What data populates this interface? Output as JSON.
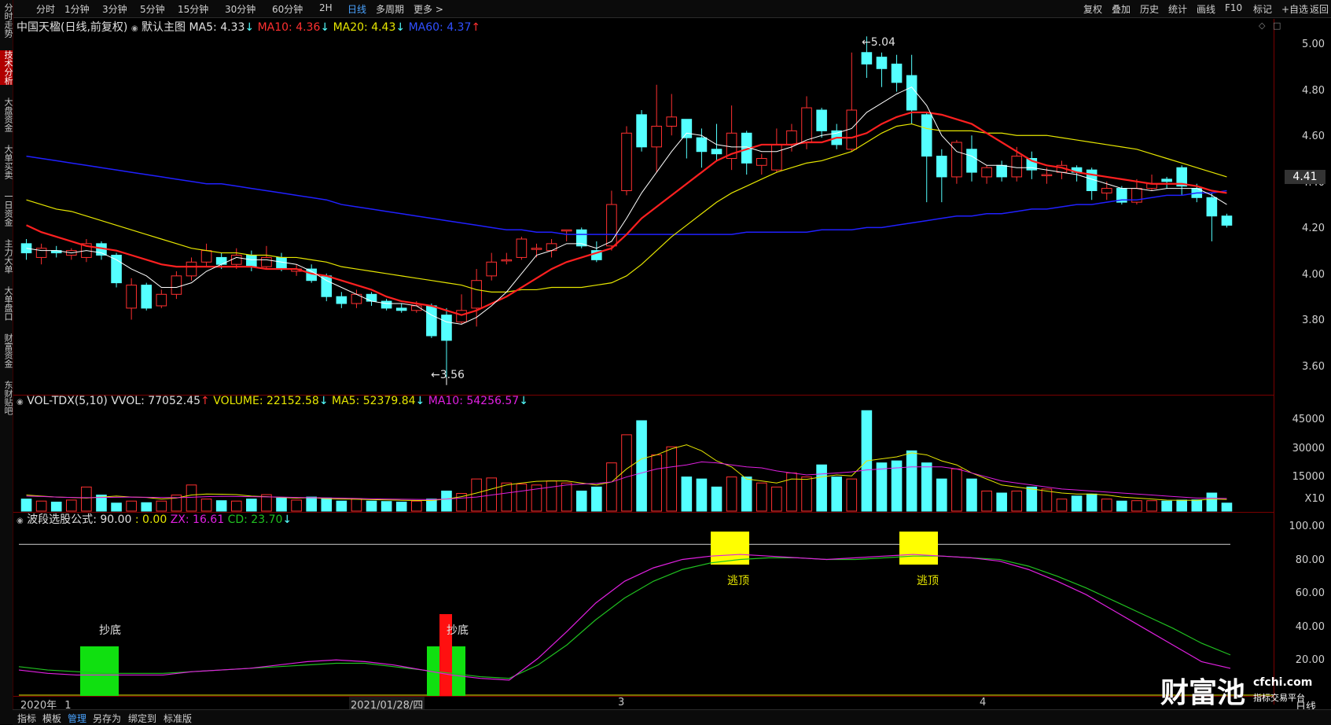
{
  "toolbar": {
    "left_tabs": [
      "分时",
      "1分钟",
      "3分钟",
      "5分钟",
      "15分钟",
      "30分钟",
      "60分钟",
      "2H",
      "日线",
      "多周期",
      "更多 >"
    ],
    "active_tab": "日线",
    "right_buttons": [
      "复权",
      "叠加",
      "历史",
      "统计",
      "画线",
      "F10",
      "标记",
      "+自选",
      "返回"
    ]
  },
  "sidebar": {
    "items": [
      "分时走势",
      "技术分析",
      "大盘资金",
      "大单买卖",
      "一日资金",
      "主力大单",
      "大单盘口",
      "财富资金",
      "东财贴吧"
    ],
    "active": "技术分析"
  },
  "main_chart": {
    "title": "中国天楹(日线,前复权)",
    "template": "默认主图",
    "ma5": "MA5: 4.33",
    "ma5_arrow": "↓",
    "ma10": "MA10: 4.36",
    "ma10_arrow": "↓",
    "ma20": "MA20: 4.43",
    "ma20_arrow": "↓",
    "ma60": "MA60: 4.37",
    "ma60_arrow": "↑",
    "high_label": "5.04",
    "low_label": "3.56",
    "last_price": "4.41",
    "price_ticks": [
      "5.00",
      "4.80",
      "4.60",
      "4.40",
      "4.20",
      "4.00",
      "3.80",
      "3.60"
    ]
  },
  "volume_panel": {
    "name": "VOL-TDX(5,10)",
    "vvol": "VVOL: 77052.45",
    "vvol_arrow": "↑",
    "volume": "VOLUME: 22152.58",
    "volume_arrow": "↓",
    "ma5": "MA5: 52379.84",
    "ma5_arrow": "↓",
    "ma10": "MA10: 54256.57",
    "ma10_arrow": "↓",
    "ticks": [
      "45000",
      "30000",
      "15000",
      "X10"
    ]
  },
  "indicator_panel": {
    "name": "波段选股公式",
    "value1": ": 90.00",
    "value2": ": 0.00",
    "zx": "ZX: 16.61",
    "cd": "CD: 23.70",
    "cd_arrow": "↓",
    "ticks": [
      "100.00",
      "80.00",
      "60.00",
      "40.00",
      "20.00"
    ],
    "signals": {
      "top1": "逃顶",
      "top2": "逃顶",
      "bottom1": "抄底",
      "bottom2": "抄底"
    }
  },
  "dates": {
    "year": "2020年",
    "m1": "1",
    "cursor_date": "2021/01/28/四",
    "m3": "3",
    "m4": "4"
  },
  "bottom_bar": {
    "items": [
      "指标",
      "模板",
      "管理",
      "另存为",
      "绑定到",
      "标准版"
    ],
    "active": "管理",
    "period": "日线"
  },
  "watermark": {
    "brand": "财富池",
    "domain": "cfchi.com",
    "slogan": "指标交易平台"
  },
  "colors": {
    "up": "#ff3030",
    "down": "#54ffff",
    "ma5": "#ffffff",
    "ma10": "#ff2020",
    "ma20": "#e6e600",
    "ma60": "#2020ff",
    "zx": "#e020e0",
    "cd": "#20c020"
  },
  "chart_data": [
    {
      "type": "candlestick",
      "ylim": [
        3.5,
        5.1
      ],
      "candles": [
        [
          4.14,
          4.1,
          4.16,
          4.07
        ],
        [
          4.08,
          4.12,
          4.14,
          4.05
        ],
        [
          4.11,
          4.1,
          4.13,
          4.08
        ],
        [
          4.09,
          4.11,
          4.12,
          4.07
        ],
        [
          4.08,
          4.14,
          4.16,
          4.06
        ],
        [
          4.14,
          4.09,
          4.15,
          4.07
        ],
        [
          4.09,
          3.97,
          4.1,
          3.95
        ],
        [
          3.86,
          3.96,
          3.99,
          3.81
        ],
        [
          3.96,
          3.86,
          3.97,
          3.85
        ],
        [
          3.87,
          3.92,
          3.94,
          3.86
        ],
        [
          3.92,
          4.0,
          4.02,
          3.9
        ],
        [
          4.0,
          4.06,
          4.08,
          3.98
        ],
        [
          4.06,
          4.11,
          4.14,
          4.04
        ],
        [
          4.08,
          4.05,
          4.1,
          4.03
        ],
        [
          4.05,
          4.09,
          4.12,
          4.03
        ],
        [
          4.09,
          4.04,
          4.11,
          4.02
        ],
        [
          4.04,
          4.08,
          4.13,
          4.03
        ],
        [
          4.08,
          4.03,
          4.1,
          4.02
        ],
        [
          4.02,
          4.03,
          4.05,
          4.0
        ],
        [
          4.03,
          3.98,
          4.05,
          3.97
        ],
        [
          4.0,
          3.91,
          4.01,
          3.89
        ],
        [
          3.91,
          3.88,
          3.93,
          3.86
        ],
        [
          3.88,
          3.92,
          3.94,
          3.86
        ],
        [
          3.92,
          3.89,
          3.93,
          3.87
        ],
        [
          3.89,
          3.86,
          3.9,
          3.85
        ],
        [
          3.86,
          3.85,
          3.88,
          3.84
        ],
        [
          3.85,
          3.87,
          3.89,
          3.84
        ],
        [
          3.87,
          3.74,
          3.88,
          3.73
        ],
        [
          3.83,
          3.72,
          3.86,
          3.56
        ],
        [
          3.8,
          3.85,
          3.92,
          3.79
        ],
        [
          3.86,
          3.98,
          4.03,
          3.78
        ],
        [
          4.0,
          4.06,
          4.1,
          3.98
        ],
        [
          4.07,
          4.07,
          4.1,
          4.05
        ],
        [
          4.08,
          4.16,
          4.17,
          4.07
        ],
        [
          4.12,
          4.12,
          4.14,
          4.08
        ],
        [
          4.11,
          4.14,
          4.16,
          4.08
        ],
        [
          4.2,
          4.2,
          4.2,
          4.15
        ],
        [
          4.2,
          4.13,
          4.21,
          4.12
        ],
        [
          4.11,
          4.07,
          4.15,
          4.06
        ],
        [
          4.13,
          4.31,
          4.37,
          4.11
        ],
        [
          4.37,
          4.62,
          4.65,
          4.35
        ],
        [
          4.7,
          4.56,
          4.72,
          4.54
        ],
        [
          4.56,
          4.65,
          4.83,
          4.45
        ],
        [
          4.65,
          4.69,
          4.79,
          4.61
        ],
        [
          4.68,
          4.6,
          4.68,
          4.51
        ],
        [
          4.6,
          4.54,
          4.64,
          4.47
        ],
        [
          4.55,
          4.53,
          4.66,
          4.5
        ],
        [
          4.51,
          4.62,
          4.74,
          4.46
        ],
        [
          4.62,
          4.49,
          4.63,
          4.44
        ],
        [
          4.48,
          4.51,
          4.53,
          4.44
        ],
        [
          4.46,
          4.57,
          4.64,
          4.45
        ],
        [
          4.57,
          4.63,
          4.66,
          4.54
        ],
        [
          4.58,
          4.73,
          4.78,
          4.55
        ],
        [
          4.72,
          4.63,
          4.73,
          4.6
        ],
        [
          4.63,
          4.57,
          4.66,
          4.55
        ],
        [
          4.55,
          4.72,
          4.97,
          4.54
        ],
        [
          4.97,
          4.92,
          5.04,
          4.86
        ],
        [
          4.95,
          4.9,
          4.97,
          4.82
        ],
        [
          4.92,
          4.84,
          4.96,
          4.8
        ],
        [
          4.87,
          4.72,
          4.96,
          4.66
        ],
        [
          4.7,
          4.52,
          4.71,
          4.32
        ],
        [
          4.52,
          4.43,
          4.55,
          4.32
        ],
        [
          4.43,
          4.58,
          4.59,
          4.4
        ],
        [
          4.55,
          4.45,
          4.61,
          4.41
        ],
        [
          4.43,
          4.47,
          4.48,
          4.4
        ],
        [
          4.48,
          4.43,
          4.5,
          4.41
        ],
        [
          4.43,
          4.52,
          4.56,
          4.41
        ],
        [
          4.51,
          4.46,
          4.54,
          4.42
        ],
        [
          4.44,
          4.44,
          4.47,
          4.4
        ],
        [
          4.45,
          4.48,
          4.5,
          4.42
        ],
        [
          4.47,
          4.45,
          4.48,
          4.41
        ],
        [
          4.46,
          4.37,
          4.47,
          4.33
        ],
        [
          4.36,
          4.38,
          4.41,
          4.33
        ],
        [
          4.38,
          4.32,
          4.39,
          4.31
        ],
        [
          4.32,
          4.38,
          4.42,
          4.31
        ],
        [
          4.38,
          4.4,
          4.44,
          4.37
        ],
        [
          4.42,
          4.41,
          4.43,
          4.38
        ],
        [
          4.47,
          4.39,
          4.48,
          4.35
        ],
        [
          4.38,
          4.34,
          4.4,
          4.32
        ],
        [
          4.34,
          4.26,
          4.36,
          4.15
        ],
        [
          4.26,
          4.22,
          4.27,
          4.21
        ]
      ],
      "ma5": [
        4.12,
        4.11,
        4.11,
        4.1,
        4.11,
        4.1,
        4.07,
        4.03,
        4.0,
        3.95,
        3.95,
        3.97,
        4.02,
        4.05,
        4.08,
        4.07,
        4.07,
        4.06,
        4.05,
        4.02,
        3.98,
        3.95,
        3.92,
        3.89,
        3.88,
        3.88,
        3.87,
        3.83,
        3.8,
        3.79,
        3.82,
        3.87,
        3.93,
        4.01,
        4.09,
        4.11,
        4.14,
        4.14,
        4.12,
        4.15,
        4.25,
        4.36,
        4.45,
        4.54,
        4.62,
        4.61,
        4.57,
        4.56,
        4.56,
        4.54,
        4.54,
        4.56,
        4.59,
        4.61,
        4.62,
        4.64,
        4.71,
        4.75,
        4.79,
        4.82,
        4.74,
        4.61,
        4.54,
        4.52,
        4.48,
        4.48,
        4.47,
        4.47,
        4.46,
        4.45,
        4.44,
        4.42,
        4.4,
        4.38,
        4.38,
        4.37,
        4.38,
        4.38,
        4.38,
        4.35,
        4.31
      ],
      "ma10": [
        4.22,
        4.19,
        4.17,
        4.15,
        4.13,
        4.12,
        4.11,
        4.09,
        4.07,
        4.05,
        4.04,
        4.04,
        4.04,
        4.04,
        4.04,
        4.04,
        4.03,
        4.03,
        4.03,
        4.01,
        4.0,
        3.98,
        3.96,
        3.94,
        3.91,
        3.89,
        3.88,
        3.87,
        3.85,
        3.83,
        3.85,
        3.88,
        3.91,
        3.95,
        3.99,
        4.03,
        4.06,
        4.08,
        4.1,
        4.12,
        4.18,
        4.25,
        4.3,
        4.35,
        4.4,
        4.45,
        4.5,
        4.53,
        4.55,
        4.57,
        4.57,
        4.57,
        4.58,
        4.58,
        4.6,
        4.6,
        4.62,
        4.66,
        4.69,
        4.71,
        4.71,
        4.7,
        4.68,
        4.66,
        4.62,
        4.58,
        4.54,
        4.5,
        4.48,
        4.47,
        4.45,
        4.44,
        4.43,
        4.42,
        4.41,
        4.4,
        4.4,
        4.4,
        4.39,
        4.37,
        4.36
      ],
      "ma20": [
        4.33,
        4.31,
        4.29,
        4.28,
        4.26,
        4.24,
        4.22,
        4.2,
        4.18,
        4.16,
        4.14,
        4.12,
        4.11,
        4.1,
        4.1,
        4.09,
        4.09,
        4.08,
        4.08,
        4.07,
        4.06,
        4.04,
        4.03,
        4.02,
        4.01,
        4.0,
        3.99,
        3.98,
        3.97,
        3.96,
        3.94,
        3.93,
        3.93,
        3.94,
        3.94,
        3.95,
        3.95,
        3.95,
        3.96,
        3.97,
        4.0,
        4.05,
        4.11,
        4.17,
        4.22,
        4.27,
        4.32,
        4.36,
        4.39,
        4.42,
        4.45,
        4.47,
        4.49,
        4.5,
        4.52,
        4.54,
        4.58,
        4.62,
        4.65,
        4.66,
        4.64,
        4.63,
        4.63,
        4.63,
        4.62,
        4.62,
        4.61,
        4.61,
        4.61,
        4.6,
        4.59,
        4.58,
        4.57,
        4.56,
        4.55,
        4.53,
        4.51,
        4.49,
        4.47,
        4.45,
        4.43
      ],
      "ma60": [
        4.52,
        4.51,
        4.5,
        4.49,
        4.48,
        4.47,
        4.46,
        4.45,
        4.44,
        4.43,
        4.42,
        4.41,
        4.4,
        4.4,
        4.39,
        4.38,
        4.37,
        4.36,
        4.35,
        4.34,
        4.33,
        4.31,
        4.3,
        4.29,
        4.28,
        4.27,
        4.26,
        4.25,
        4.24,
        4.23,
        4.22,
        4.21,
        4.2,
        4.2,
        4.19,
        4.19,
        4.18,
        4.18,
        4.18,
        4.18,
        4.18,
        4.18,
        4.18,
        4.18,
        4.18,
        4.18,
        4.18,
        4.18,
        4.19,
        4.19,
        4.19,
        4.19,
        4.19,
        4.2,
        4.2,
        4.2,
        4.21,
        4.21,
        4.22,
        4.23,
        4.24,
        4.25,
        4.26,
        4.26,
        4.27,
        4.27,
        4.28,
        4.29,
        4.29,
        4.3,
        4.31,
        4.31,
        4.32,
        4.33,
        4.33,
        4.34,
        4.35,
        4.35,
        4.36,
        4.36,
        4.37
      ]
    },
    {
      "type": "bar",
      "ylim": [
        0,
        50000
      ],
      "volume": [
        6000,
        5000,
        4500,
        5500,
        12000,
        8000,
        4000,
        5000,
        4200,
        5000,
        8000,
        13000,
        6000,
        5200,
        5000,
        6000,
        8200,
        6500,
        5500,
        7000,
        6500,
        5000,
        6200,
        5000,
        4800,
        4500,
        5000,
        6000,
        10000,
        8800,
        16000,
        16500,
        14000,
        13500,
        13000,
        15000,
        14000,
        10000,
        12000,
        24000,
        38000,
        45000,
        28000,
        32000,
        17000,
        16000,
        12000,
        17000,
        17000,
        14000,
        12000,
        19000,
        17000,
        23000,
        17000,
        16000,
        50000,
        24000,
        25000,
        30000,
        24000,
        16000,
        21000,
        16000,
        10000,
        9000,
        10000,
        12000,
        11000,
        6000,
        7500,
        8500,
        6000,
        5000,
        5200,
        5200,
        5000,
        5500,
        5600,
        9000,
        4000
      ],
      "ma5": [
        8000,
        7500,
        7000,
        6800,
        6500,
        7000,
        7500,
        7000,
        6800,
        6000,
        6500,
        8000,
        8500,
        8400,
        8200,
        7500,
        7200,
        6800,
        6500,
        6700,
        6200,
        6000,
        5900,
        5700,
        5600,
        5400,
        5300,
        5300,
        6000,
        7200,
        9000,
        11000,
        13000,
        14000,
        14800,
        15000,
        15000,
        14000,
        13000,
        14500,
        21000,
        26000,
        28000,
        31000,
        33000,
        30000,
        25000,
        22000,
        16000,
        15000,
        14000,
        16000,
        15800,
        17000,
        18000,
        17500,
        25000,
        26000,
        27000,
        29000,
        28000,
        25000,
        23000,
        19000,
        16000,
        13000,
        12000,
        11000,
        10000,
        9000,
        8500,
        8500,
        8000,
        7000,
        6500,
        6000,
        5500,
        5400,
        5400,
        6000,
        5800
      ],
      "ma10": [
        7500,
        7300,
        7000,
        6800,
        6700,
        6800,
        6900,
        7000,
        6900,
        6800,
        6700,
        6900,
        7200,
        7400,
        7300,
        7200,
        7100,
        7000,
        6800,
        6700,
        6600,
        6500,
        6300,
        6100,
        6000,
        5900,
        5800,
        5700,
        6000,
        6500,
        7000,
        8000,
        9000,
        10000,
        11000,
        12000,
        13000,
        13500,
        13800,
        14500,
        17000,
        19000,
        21000,
        22000,
        23000,
        24500,
        24000,
        23000,
        22000,
        21500,
        20000,
        19000,
        18000,
        18500,
        19000,
        19500,
        20500,
        21000,
        21500,
        22000,
        22000,
        22000,
        21000,
        19000,
        17000,
        15000,
        14000,
        13000,
        12000,
        11000,
        10500,
        10000,
        9500,
        9000,
        8500,
        8000,
        7500,
        7000,
        6500,
        6400,
        6300
      ]
    },
    {
      "type": "line",
      "ylim": [
        0,
        100
      ],
      "zx": [
        15,
        13,
        12,
        12,
        12,
        12,
        14,
        15,
        16,
        18,
        20,
        21,
        20,
        18,
        15,
        12,
        10,
        9,
        22,
        38,
        55,
        68,
        76,
        81,
        83,
        84,
        83,
        82,
        81,
        82,
        83,
        84,
        83,
        82,
        80,
        75,
        68,
        60,
        50,
        40,
        30,
        20,
        16
      ],
      "cd": [
        17,
        15,
        14,
        13,
        13,
        13,
        14,
        15,
        16,
        17,
        18,
        19,
        19,
        17,
        15,
        13,
        11,
        10,
        18,
        30,
        45,
        58,
        68,
        75,
        79,
        81,
        82,
        82,
        81,
        81,
        82,
        83,
        83,
        82,
        81,
        77,
        71,
        64,
        56,
        48,
        40,
        31,
        24
      ]
    }
  ]
}
